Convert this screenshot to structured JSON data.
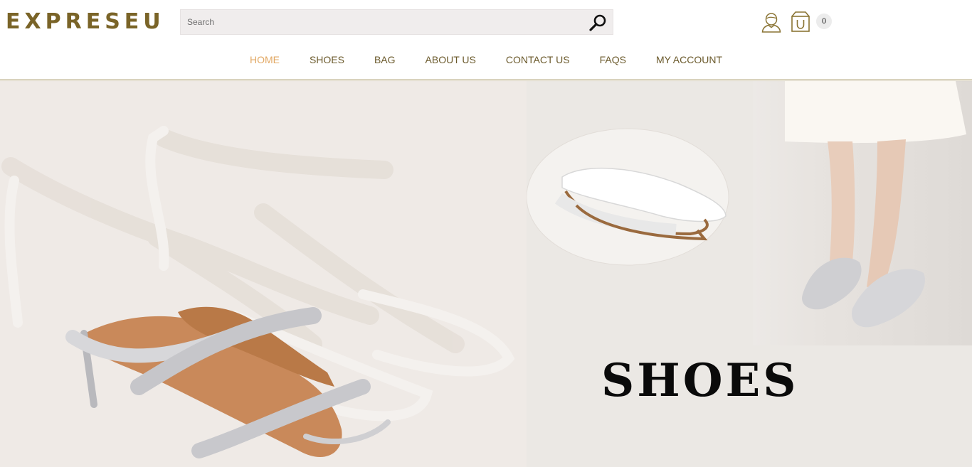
{
  "header": {
    "logo": "EXPRESEU",
    "search": {
      "placeholder": "Search"
    },
    "cart_count": "0"
  },
  "nav": {
    "items": [
      {
        "label": "HOME",
        "active": true
      },
      {
        "label": "SHOES"
      },
      {
        "label": "BAG"
      },
      {
        "label": "ABOUT US"
      },
      {
        "label": "CONTACT US"
      },
      {
        "label": "FAQS"
      },
      {
        "label": "MY ACCOUNT"
      }
    ]
  },
  "hero": {
    "title": "SHOES"
  },
  "colors": {
    "brand": "#7a6428",
    "nav_text": "#6b5a2c",
    "nav_active": "#e2a864",
    "divider": "#8a7434"
  }
}
